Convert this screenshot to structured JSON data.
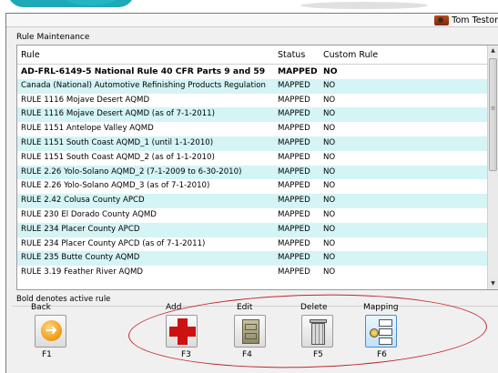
{
  "user": {
    "name": "Tom Testor"
  },
  "section_title": "Rule Maintenance",
  "table": {
    "columns": [
      "Rule",
      "Status",
      "Custom Rule"
    ],
    "rows": [
      {
        "rule": "AD-FRL-6149-5 National Rule 40 CFR Parts 9 and 59",
        "status": "MAPPED",
        "custom": "NO",
        "bold": true
      },
      {
        "rule": "Canada (National) Automotive Refinishing Products Regulation",
        "status": "MAPPED",
        "custom": "NO"
      },
      {
        "rule": "RULE 1116 Mojave Desert AQMD",
        "status": "MAPPED",
        "custom": "NO"
      },
      {
        "rule": "RULE 1116 Mojave Desert AQMD (as of 7-1-2011)",
        "status": "MAPPED",
        "custom": "NO"
      },
      {
        "rule": "RULE 1151 Antelope Valley AQMD",
        "status": "MAPPED",
        "custom": "NO"
      },
      {
        "rule": "RULE 1151 South Coast AQMD_1 (until 1-1-2010)",
        "status": "MAPPED",
        "custom": "NO"
      },
      {
        "rule": "RULE 1151 South Coast AQMD_2 (as of 1-1-2010)",
        "status": "MAPPED",
        "custom": "NO"
      },
      {
        "rule": "RULE 2.26 Yolo-Solano AQMD_2 (7-1-2009 to 6-30-2010)",
        "status": "MAPPED",
        "custom": "NO"
      },
      {
        "rule": "RULE 2.26 Yolo-Solano AQMD_3 (as of 7-1-2010)",
        "status": "MAPPED",
        "custom": "NO"
      },
      {
        "rule": "RULE 2.42 Colusa County APCD",
        "status": "MAPPED",
        "custom": "NO"
      },
      {
        "rule": "RULE 230 El Dorado County AQMD",
        "status": "MAPPED",
        "custom": "NO"
      },
      {
        "rule": "RULE 234 Placer County APCD",
        "status": "MAPPED",
        "custom": "NO"
      },
      {
        "rule": "RULE 234 Placer County APCD (as of 7-1-2011)",
        "status": "MAPPED",
        "custom": "NO"
      },
      {
        "rule": "RULE 235 Butte County AQMD",
        "status": "MAPPED",
        "custom": "NO"
      },
      {
        "rule": "RULE 3.19 Feather River AQMD",
        "status": "MAPPED",
        "custom": "NO"
      }
    ]
  },
  "footnote": "Bold denotes active rule",
  "buttons": {
    "back": {
      "label": "Back",
      "key": "F1"
    },
    "add": {
      "label": "Add",
      "key": "F3"
    },
    "edit": {
      "label": "Edit",
      "key": "F4"
    },
    "delete": {
      "label": "Delete",
      "key": "F5"
    },
    "mapping": {
      "label": "Mapping",
      "key": "F6"
    }
  },
  "icons": {
    "back": "arrow-left-icon",
    "add": "red-cross-icon",
    "edit": "file-cabinet-icon",
    "delete": "trash-can-icon",
    "mapping": "mapping-icon",
    "user": "user-avatar-icon"
  },
  "colors": {
    "row_alt": "#d4f4f6",
    "annotation_ring": "#c0282a",
    "add_cross": "#cc1111",
    "back_circle": "#f2a21e"
  }
}
